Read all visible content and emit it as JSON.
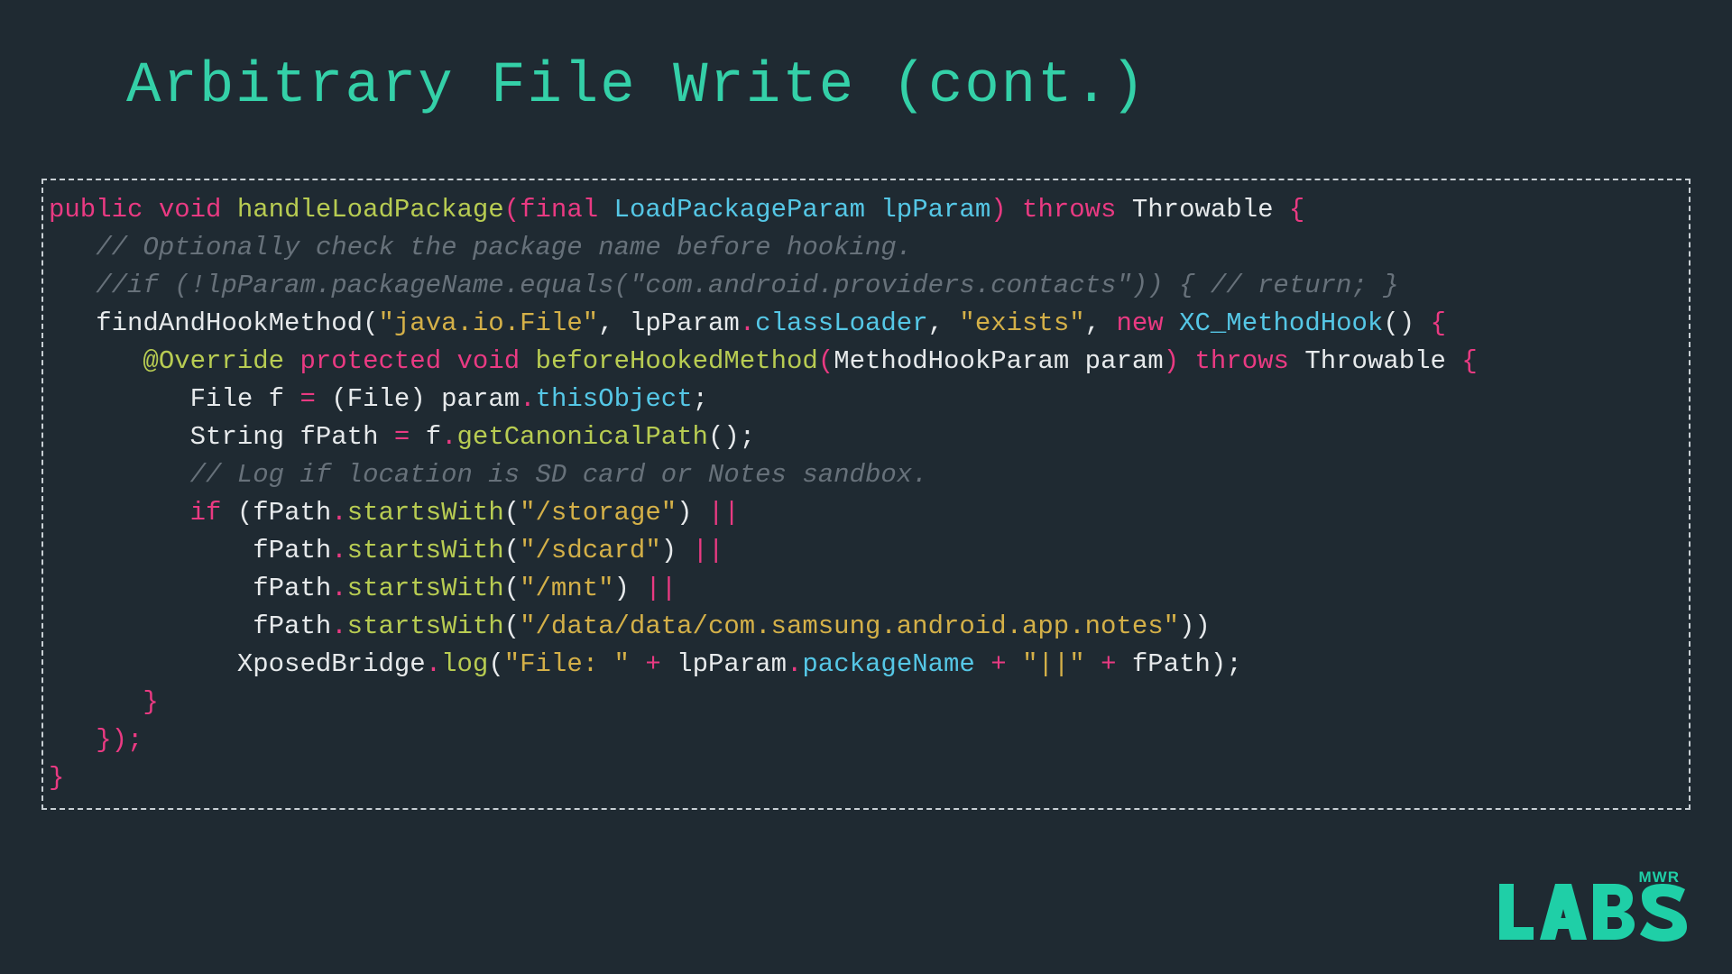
{
  "slide": {
    "title": "Arbitrary File Write (cont.)"
  },
  "code": {
    "l1": {
      "a": "public",
      "b": "void",
      "c": "handleLoadPackage",
      "d": "(",
      "e": "final",
      "f": "LoadPackageParam",
      "g": "lpParam",
      "h": ")",
      "i": "throws",
      "j": "Throwable",
      "k": "{"
    },
    "l2": "// Optionally check the package name before hooking.",
    "l3": "//if (!lpParam.packageName.equals(\"com.android.providers.contacts\")) { // return; }",
    "l4": {
      "a": "findAndHookMethod",
      "b": "(",
      "c": "\"java.io.File\"",
      "d": ", lpParam",
      "e": ".",
      "f": "classLoader",
      "g": ", ",
      "h": "\"exists\"",
      "i": ", ",
      "j": "new",
      "k": "XC_MethodHook",
      "l": "()",
      "m": "{"
    },
    "l5": {
      "a": "@Override",
      "b": "protected",
      "c": "void",
      "d": "beforeHookedMethod",
      "e": "(",
      "f": "MethodHookParam",
      "g": "param",
      "h": ")",
      "i": "throws",
      "j": "Throwable",
      "k": "{"
    },
    "l6": {
      "a": "File",
      "b": "f",
      "c": "=",
      "d": "(",
      "e": "File",
      "f": ")",
      "g": "param",
      "h": ".",
      "i": "thisObject",
      "j": ";"
    },
    "l7": {
      "a": "String",
      "b": "fPath",
      "c": "=",
      "d": "f",
      "e": ".",
      "f": "getCanonicalPath",
      "g": "();"
    },
    "l8": "// Log if location is SD card or Notes sandbox.",
    "l9": {
      "a": "if",
      "b": "(fPath",
      "c": ".",
      "d": "startsWith",
      "e": "(",
      "f": "\"/storage\"",
      "g": ")",
      "h": "||"
    },
    "l10": {
      "a": "fPath",
      "b": ".",
      "c": "startsWith",
      "d": "(",
      "e": "\"/sdcard\"",
      "f": ")",
      "g": "||"
    },
    "l11": {
      "a": "fPath",
      "b": ".",
      "c": "startsWith",
      "d": "(",
      "e": "\"/mnt\"",
      "f": ")",
      "g": "||"
    },
    "l12": {
      "a": "fPath",
      "b": ".",
      "c": "startsWith",
      "d": "(",
      "e": "\"/data/data/com.samsung.android.app.notes\"",
      "f": "))"
    },
    "l13": {
      "a": "XposedBridge",
      "b": ".",
      "c": "log",
      "d": "(",
      "e": "\"File: \"",
      "f": "+",
      "g": "lpParam",
      "h": ".",
      "i": "packageName",
      "j": "+",
      "k": "\"||\"",
      "l": "+",
      "m": "fPath",
      "n": ");"
    },
    "l14": "}",
    "l15": "});",
    "l16": "}"
  },
  "logo": {
    "mwr": "MWR",
    "labs": "LABS"
  }
}
